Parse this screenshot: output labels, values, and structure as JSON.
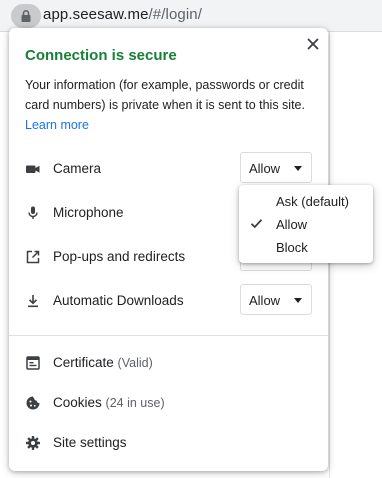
{
  "address_bar": {
    "domain": "app.seesaw.me",
    "path": "/#/login/"
  },
  "popup": {
    "title": "Connection is secure",
    "close_icon": "close-icon",
    "description": "Your information (for example, passwords or credit card numbers) is private when it is sent to this site.",
    "learn_more": "Learn more",
    "permissions": [
      {
        "label": "Camera",
        "icon": "camera-icon",
        "value": "Allow"
      },
      {
        "label": "Microphone",
        "icon": "microphone-icon",
        "value": ""
      },
      {
        "label": "Pop-ups and redirects",
        "icon": "open-external-icon",
        "value": ""
      },
      {
        "label": "Automatic Downloads",
        "icon": "download-icon",
        "value": "Allow"
      }
    ],
    "links": [
      {
        "label": "Certificate",
        "sub": "(Valid)",
        "icon": "certificate-icon"
      },
      {
        "label": "Cookies",
        "sub": "(24 in use)",
        "icon": "cookie-icon"
      },
      {
        "label": "Site settings",
        "sub": "",
        "icon": "gear-icon"
      }
    ]
  },
  "dropdown_menu": {
    "options": [
      "Ask (default)",
      "Allow",
      "Block"
    ],
    "selected": "Allow"
  },
  "colors": {
    "secure_green": "#188038",
    "link_blue": "#1a73e8"
  }
}
